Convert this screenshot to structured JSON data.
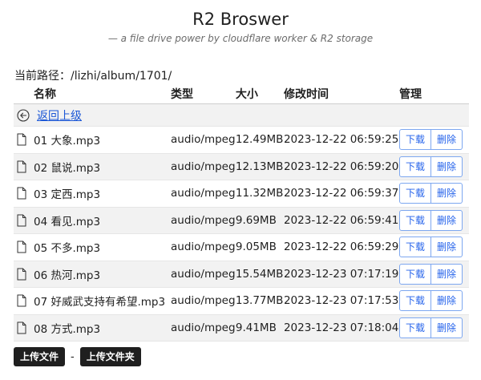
{
  "header": {
    "title": "R2 Broswer",
    "subtitle": "— a file drive power by cloudflare worker & R2 storage"
  },
  "path": {
    "text": "当前路径：/lizhi/album/1701/"
  },
  "table": {
    "columns": [
      "名称",
      "类型",
      "大小",
      "修改时间",
      "管理"
    ],
    "back_label": "返回上级",
    "rows": [
      {
        "name": "01 大象.mp3",
        "type": "audio/mpeg",
        "size": "12.49MB",
        "time": "2023-12-22 06:59:25"
      },
      {
        "name": "02 鼠说.mp3",
        "type": "audio/mpeg",
        "size": "12.13MB",
        "time": "2023-12-22 06:59:20"
      },
      {
        "name": "03 定西.mp3",
        "type": "audio/mpeg",
        "size": "11.32MB",
        "time": "2023-12-22 06:59:37"
      },
      {
        "name": "04 看见.mp3",
        "type": "audio/mpeg",
        "size": "9.69MB",
        "time": "2023-12-22 06:59:41"
      },
      {
        "name": "05 不多.mp3",
        "type": "audio/mpeg",
        "size": "9.05MB",
        "time": "2023-12-22 06:59:29"
      },
      {
        "name": "06 热河.mp3",
        "type": "audio/mpeg",
        "size": "15.54MB",
        "time": "2023-12-23 07:17:19"
      },
      {
        "name": "07 好威武支持有希望.mp3",
        "type": "audio/mpeg",
        "size": "13.77MB",
        "time": "2023-12-23 07:17:53"
      },
      {
        "name": "08 方式.mp3",
        "type": "audio/mpeg",
        "size": "9.41MB",
        "time": "2023-12-23 07:18:04"
      }
    ],
    "download_label": "下载",
    "delete_label": "删除"
  },
  "footer": {
    "upload_file_label": "上传文件",
    "separator": "-",
    "upload_folder_label": "上传文件夹"
  },
  "icons": {
    "file": "file-icon",
    "back": "back-arrow-icon"
  },
  "colors": {
    "link": "#1a56d6",
    "button_border": "#7da7f0",
    "button_text": "#2563eb",
    "dark_button": "#1f1f1f"
  }
}
